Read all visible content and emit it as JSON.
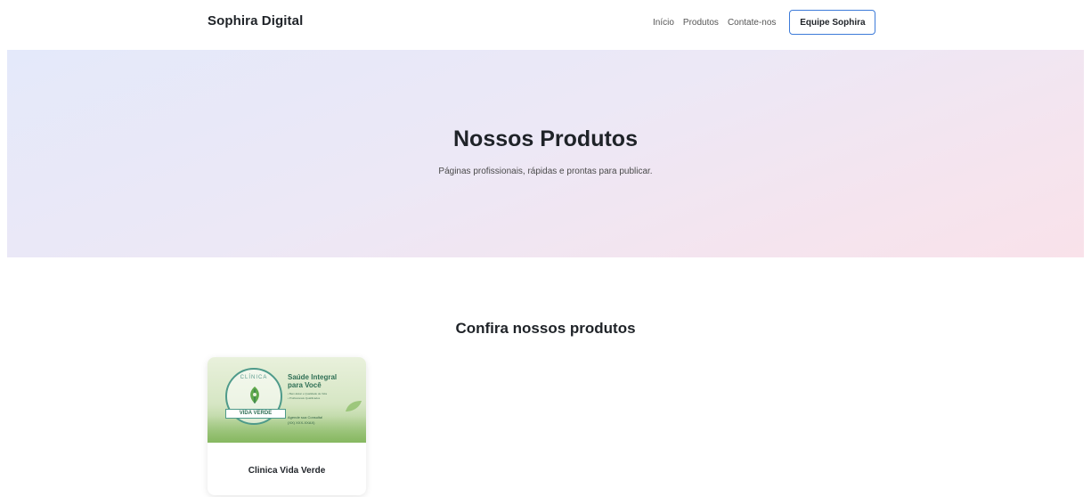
{
  "header": {
    "brand": "Sophira Digital",
    "nav": [
      {
        "label": "Início"
      },
      {
        "label": "Produtos"
      },
      {
        "label": "Contate-nos"
      }
    ],
    "cta_label": "Equipe Sophira"
  },
  "hero": {
    "title": "Nossos Produtos",
    "subtitle": "Páginas profissionais, rápidas e prontas para publicar."
  },
  "products_section": {
    "title": "Confira nossos produtos",
    "products": [
      {
        "name": "Clinica Vida Verde",
        "image": {
          "logo_top": "CLÍNICA",
          "logo_banner": "VIDA VERDE",
          "headline_line1": "Saúde Integral",
          "headline_line2": "para Você",
          "bullet1": "• Bem-Estar e Qualidade de Vida",
          "bullet2": "• Profissionais Qualificados",
          "contact_line1": "Agende sua Consulta!",
          "contact_line2": "(XX) XXX-XXAX)"
        }
      }
    ]
  },
  "colors": {
    "accent_border": "#3d7bd9",
    "hero_gradient_start": "#e4e9fa",
    "hero_gradient_end": "#f9e2ea",
    "brand_green": "#2f6f55"
  }
}
